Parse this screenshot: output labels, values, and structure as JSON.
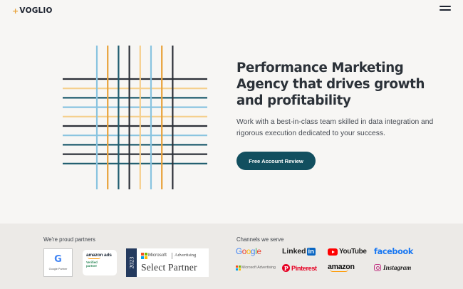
{
  "header": {
    "logo_mark": "+",
    "logo_text": "VOGLIO"
  },
  "hero": {
    "title": "Performance Marketing Agency that drives growth and profitability",
    "subtitle": "Work with a best-in-class team skilled in data integration and rigorous execution dedicated to your success.",
    "cta_label": "Free Account Review",
    "art": {
      "vertical_colors": [
        "#89c4e0",
        "#e8a23a",
        "#1e5c6e",
        "#2c3038",
        "#f5cf8c",
        "#89c4e0",
        "#e8a23a",
        "#2c3038"
      ],
      "horizontal_colors": [
        "#2c3038",
        "#f5cf8c",
        "#1e5c6e",
        "#89c4e0",
        "#f5cf8c",
        "#2c3038",
        "#89c4e0",
        "#1e5c6e",
        "#2c3038",
        "#1e5c6e"
      ]
    }
  },
  "partners": {
    "label": "We're proud partners",
    "google_partner": "Google Partner",
    "amazon_ads": {
      "title": "amazon ads",
      "line1": "Verified",
      "line2": "partner"
    },
    "microsoft": {
      "year": "2023",
      "name": "Microsoft",
      "advertising": "Advertising",
      "select_partner": "Select  Partner"
    }
  },
  "channels": {
    "label": "Channels we serve",
    "items": {
      "google": "Google",
      "linkedin_text": "Linked",
      "linkedin_in": "in",
      "youtube": "YouTube",
      "facebook": "facebook",
      "microsoft_advertising": "Microsoft Advertising",
      "pinterest": "Pinterest",
      "amazon": "amazon",
      "instagram": "Instagram"
    }
  },
  "colors": {
    "cta_bg": "#124f5f",
    "accent_orange": "#e8a23a",
    "band_bg": "#eceae7",
    "page_bg": "#f7f6f4"
  }
}
